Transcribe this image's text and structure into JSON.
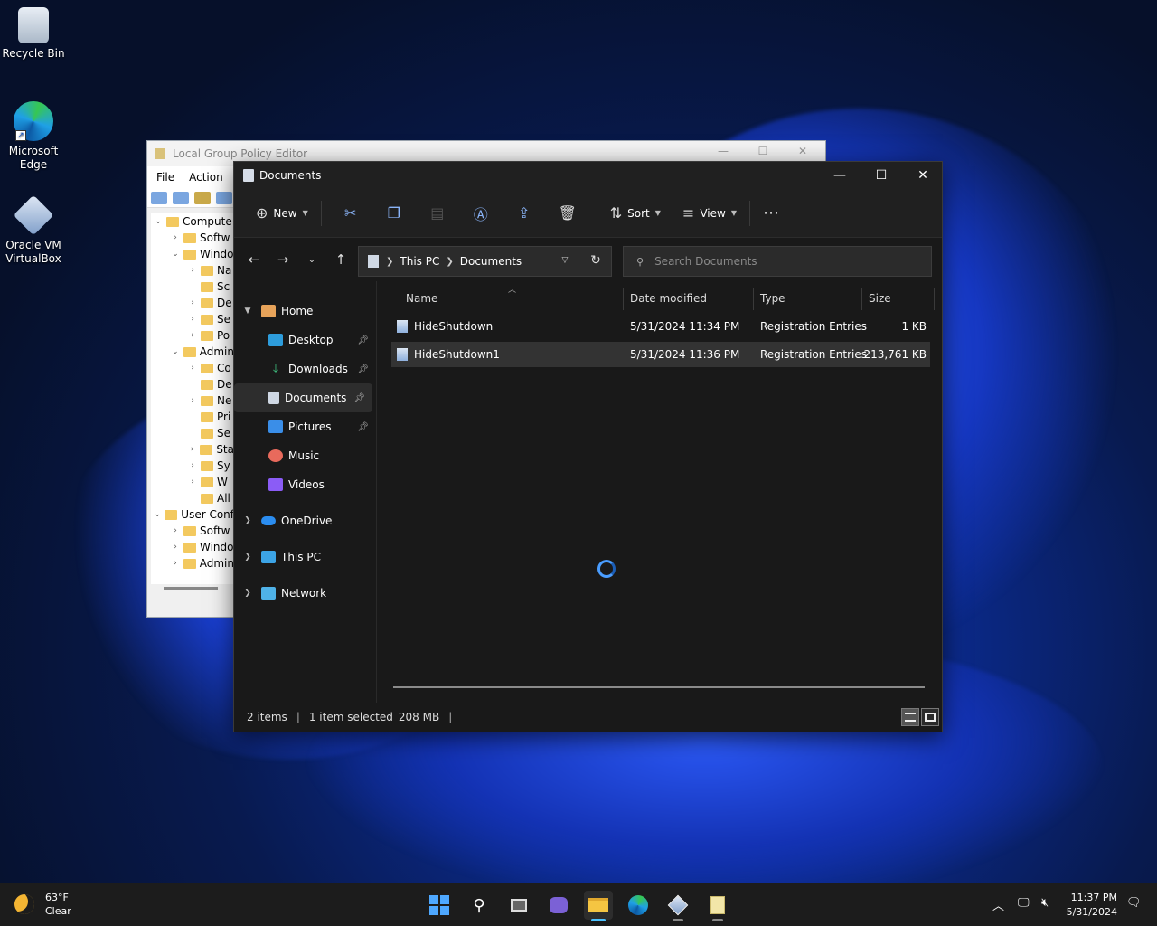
{
  "desktop": {
    "icons": [
      {
        "label_l1": "Recycle Bin",
        "label_l2": ""
      },
      {
        "label_l1": "Microsoft",
        "label_l2": "Edge"
      },
      {
        "label_l1": "Oracle VM",
        "label_l2": "VirtualBox"
      }
    ]
  },
  "gpe": {
    "title": "Local Group Policy Editor",
    "menu": [
      "File",
      "Action"
    ],
    "tree": [
      "Compute",
      "Softw",
      "Windo",
      "Na",
      "Sc",
      "De",
      "Se",
      "Po",
      "Admin",
      "Co",
      "De",
      "Ne",
      "Pri",
      "Se",
      "Sta",
      "Sy",
      "W",
      "All",
      "User Conf",
      "Softw",
      "Windo",
      "Admin"
    ]
  },
  "explorer": {
    "title": "Documents",
    "commands": {
      "new": "New",
      "sort": "Sort",
      "view": "View",
      "more": "⋯"
    },
    "breadcrumb": [
      "This PC",
      "Documents"
    ],
    "search_placeholder": "Search Documents",
    "nav": {
      "home": "Home",
      "quick": [
        "Desktop",
        "Downloads",
        "Documents",
        "Pictures",
        "Music",
        "Videos"
      ],
      "onedrive": "OneDrive",
      "thispc": "This PC",
      "network": "Network"
    },
    "columns": {
      "name": "Name",
      "date": "Date modified",
      "type": "Type",
      "size": "Size"
    },
    "files": [
      {
        "name": "HideShutdown",
        "date": "5/31/2024 11:34 PM",
        "type": "Registration Entries",
        "size": "1 KB"
      },
      {
        "name": "HideShutdown1",
        "date": "5/31/2024 11:36 PM",
        "type": "Registration Entries",
        "size": "213,761 KB"
      }
    ],
    "status": {
      "count": "2 items",
      "selection": "1 item selected",
      "size": "208 MB"
    }
  },
  "taskbar": {
    "weather_temp": "63°F",
    "weather_desc": "Clear",
    "time": "11:37 PM",
    "date": "5/31/2024"
  },
  "colors": {
    "accent": "#4cc2ff",
    "explorer_bg": "#191919",
    "selected_row": "#333333"
  }
}
